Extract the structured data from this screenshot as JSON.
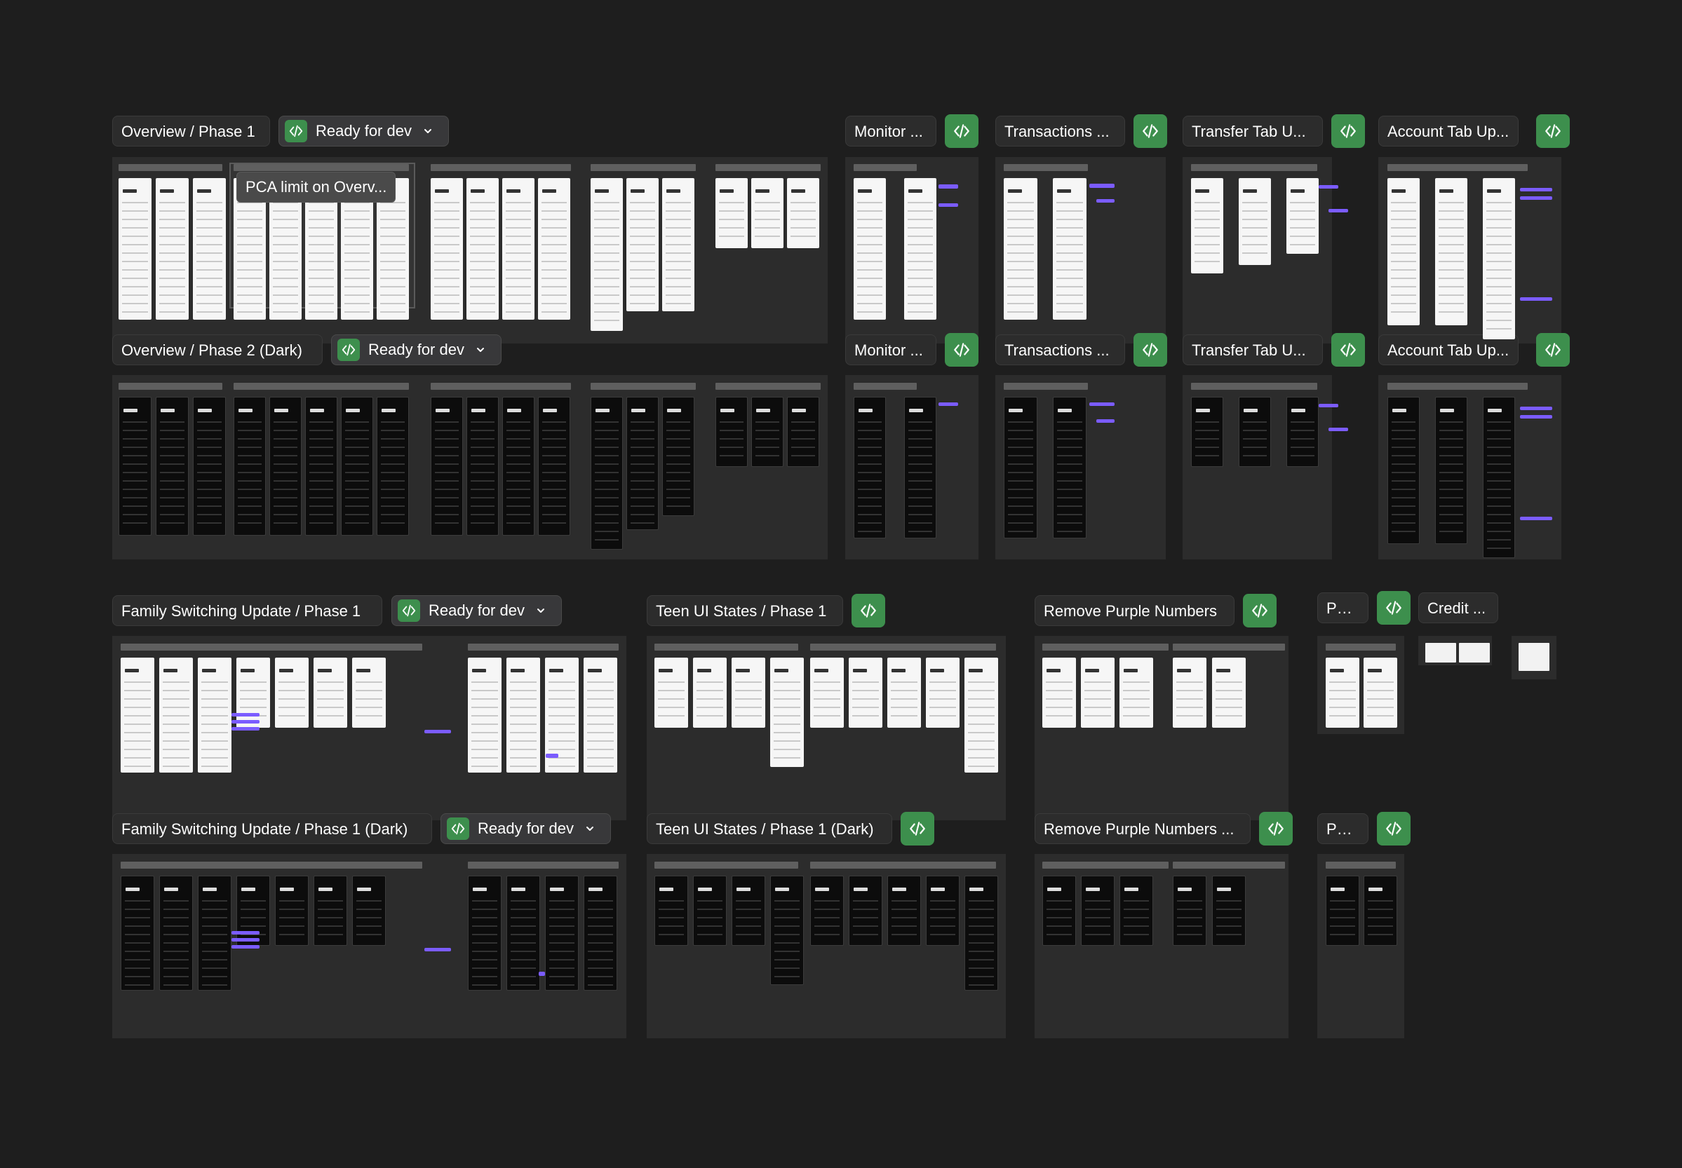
{
  "colors": {
    "canvas": "#1e1e1e",
    "section": "#2c2c2c",
    "dev_green": "#3d8f4d",
    "annotation": "#7b5cff"
  },
  "icons": {
    "dev_mode": "code-brackets-icon",
    "dropdown": "chevron-down-icon"
  },
  "status": {
    "ready_label": "Ready for dev"
  },
  "tooltip": {
    "text": "PCA limit on Overv..."
  },
  "sections": {
    "overview_p1": {
      "title": "Overview / Phase 1"
    },
    "overview_p2": {
      "title": "Overview / Phase 2 (Dark)"
    },
    "monitor_light": {
      "title": "Monitor ..."
    },
    "monitor_dark": {
      "title": "Monitor ..."
    },
    "transactions_light": {
      "title": "Transactions ..."
    },
    "transactions_dark": {
      "title": "Transactions ..."
    },
    "transfer_light": {
      "title": "Transfer Tab U..."
    },
    "transfer_dark": {
      "title": "Transfer Tab U..."
    },
    "account_light": {
      "title": "Account Tab Up..."
    },
    "account_dark": {
      "title": "Account Tab Up..."
    },
    "family_p1": {
      "title": "Family Switching Update / Phase 1"
    },
    "family_p1_dark": {
      "title": "Family Switching Update / Phase 1 (Dark)"
    },
    "teen_p1": {
      "title": "Teen UI States / Phase 1"
    },
    "teen_p1_dark": {
      "title": "Teen UI States / Phase 1 (Dark)"
    },
    "purple": {
      "title": "Remove Purple Numbers"
    },
    "purple_dark": {
      "title": "Remove Purple Numbers ..."
    },
    "pc_light": {
      "title": "PC..."
    },
    "pc_dark": {
      "title": "PC..."
    },
    "credit": {
      "title": "Credit ..."
    }
  }
}
